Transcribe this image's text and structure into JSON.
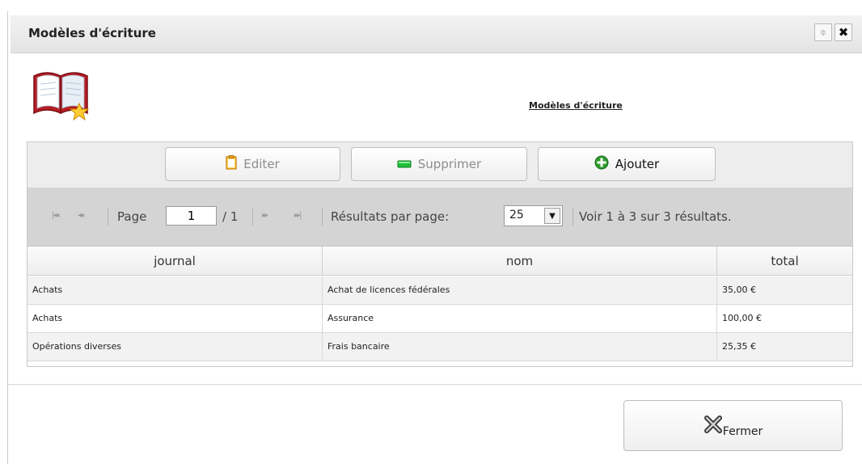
{
  "dialog": {
    "title": "Modèles d'écriture",
    "header_link": "Modèles d'écriture",
    "pin_glyph": "⌽",
    "close_glyph": "✖"
  },
  "toolbar": {
    "edit_label": "Editer",
    "delete_label": "Supprimer",
    "add_label": "Ajouter"
  },
  "pager": {
    "first_glyph": "|◂◂",
    "prev_glyph": "◂◂",
    "next_glyph": "▸▸",
    "last_glyph": "▸▸|",
    "page_label": "Page",
    "page_value": "1",
    "page_total": "/ 1",
    "per_page_label": "Résultats par page:",
    "per_page_value": "25",
    "summary": "Voir 1 à 3 sur 3 résultats."
  },
  "table": {
    "columns": [
      "journal",
      "nom",
      "total"
    ],
    "rows": [
      [
        "Achats",
        "Achat de licences fédérales",
        "35,00 €"
      ],
      [
        "Achats",
        "Assurance",
        "100,00 €"
      ],
      [
        "Opérations diverses",
        "Frais bancaire",
        "25,35 €"
      ]
    ]
  },
  "footer": {
    "close_label": "Fermer"
  },
  "icons": {
    "book": "book-icon",
    "edit": "clipboard-icon",
    "delete": "minus-icon",
    "add": "plus-icon",
    "close_footer": "x-icon"
  },
  "colors": {
    "titlebar": "#e8e8e8",
    "pager_bg": "#d4d4d4",
    "add_icon": "#2e9c2e",
    "delete_icon": "#1fbf3a",
    "book_red": "#b81d24"
  }
}
